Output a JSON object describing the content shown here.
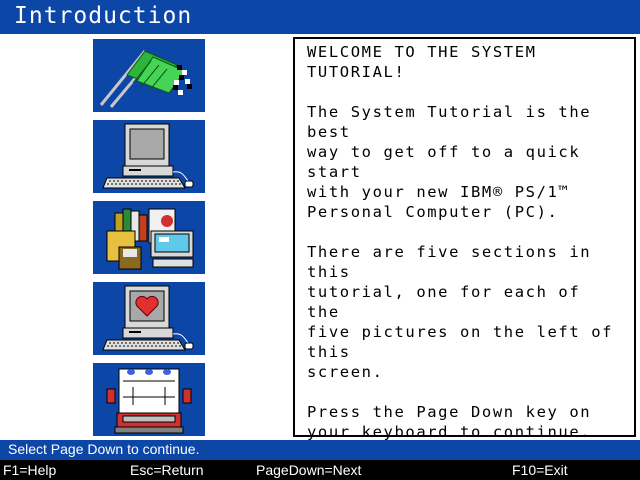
{
  "header": {
    "title": "Introduction"
  },
  "tutorial": {
    "paragraphs": [
      "WELCOME TO THE SYSTEM\nTUTORIAL!",
      "The System Tutorial is the best\nway to get off to a quick start\nwith your new IBM® PS/1™\nPersonal Computer (PC).",
      "There are five sections in this\ntutorial, one for each of the\nfive pictures on the left of this\nscreen.",
      "Press the Page Down key on\nyour keyboard to continue."
    ]
  },
  "status": {
    "message": "Select Page Down to continue."
  },
  "function_keys": {
    "help": "F1=Help",
    "return": "Esc=Return",
    "next": "PageDown=Next",
    "exit": "F10=Exit"
  },
  "colors": {
    "accent_blue": "#0c46a6",
    "heart_red": "#e03030",
    "flag_green": "#2cb43c"
  },
  "section_icons": [
    "checkered-flags-icon",
    "computer-icon",
    "books-and-software-icon",
    "computer-heart-icon",
    "rolodex-icon"
  ]
}
